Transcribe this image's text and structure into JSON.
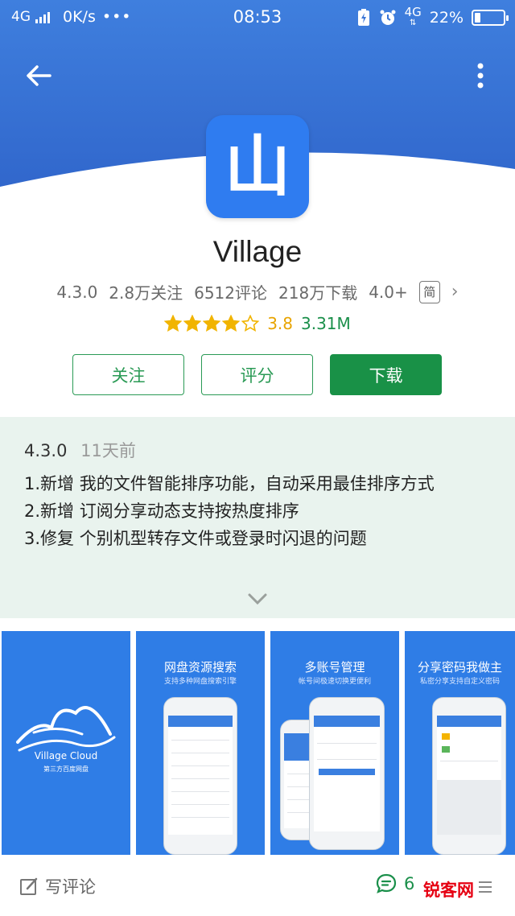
{
  "status_bar": {
    "network": "4G",
    "speed": "0K/s",
    "dots": "•••",
    "time": "08:53",
    "network_right": "4G",
    "battery_text": "22%",
    "battery_level": 0.22
  },
  "app": {
    "icon_glyph": "山",
    "name": "Village",
    "version": "4.3.0",
    "followers": "2.8万关注",
    "comments": "6512评论",
    "downloads": "218万下载",
    "android_req": "4.0+",
    "lang_badge": "简",
    "rating_value": "3.8",
    "rating_count": "3.31M",
    "stars": 3.8
  },
  "actions": {
    "follow": "关注",
    "rate": "评分",
    "download": "下载"
  },
  "changelog": {
    "version": "4.3.0",
    "date": "11天前",
    "line1": "1.新增 我的文件智能排序功能，自动采用最佳排序方式",
    "line2": "2.新增 订阅分享动态支持按热度排序",
    "line3": "3.修复 个别机型转存文件或登录时闪退的问题"
  },
  "screenshots": [
    {
      "title": "",
      "subtitle": "",
      "logo_text": "Village Cloud",
      "logo_sub": "第三方百度网盘"
    },
    {
      "title": "网盘资源搜索",
      "subtitle": "支持多种网盘搜索引擎"
    },
    {
      "title": "多账号管理",
      "subtitle": "帐号间极速切换更便利"
    },
    {
      "title": "分享密码我做主",
      "subtitle": "私密分享支持自定义密码"
    }
  ],
  "bottom_bar": {
    "write_review": "写评论",
    "comment_count": "6",
    "watermark": "锐客网"
  },
  "colors": {
    "header_blue": "#3a78d8",
    "accent_green": "#199147",
    "star_gold": "#f1b400",
    "changelog_bg": "#e9f3ee"
  },
  "icons": [
    "back-arrow-icon",
    "more-vert-icon",
    "star-icon",
    "chevron-right-icon",
    "chevron-down-icon",
    "edit-icon",
    "comment-icon",
    "menu-icon"
  ]
}
